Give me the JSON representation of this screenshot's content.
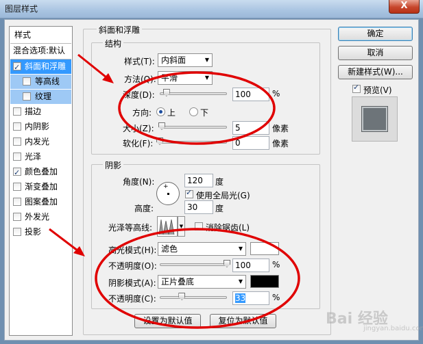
{
  "window": {
    "title": "图层样式",
    "close_glyph": "X"
  },
  "style_list": {
    "header": "样式",
    "blend_default": "混合选项:默认",
    "items": [
      {
        "label": "斜面和浮雕",
        "checked": true,
        "selected": true
      },
      {
        "label": "等高线",
        "checked": false,
        "sub": true
      },
      {
        "label": "纹理",
        "checked": false,
        "sub": true
      },
      {
        "label": "描边",
        "checked": false
      },
      {
        "label": "内阴影",
        "checked": false
      },
      {
        "label": "内发光",
        "checked": false
      },
      {
        "label": "光泽",
        "checked": false
      },
      {
        "label": "颜色叠加",
        "checked": true
      },
      {
        "label": "渐变叠加",
        "checked": false
      },
      {
        "label": "图案叠加",
        "checked": false
      },
      {
        "label": "外发光",
        "checked": false
      },
      {
        "label": "投影",
        "checked": false
      }
    ]
  },
  "bevel": {
    "group_title": "斜面和浮雕",
    "structure_title": "结构",
    "style_label": "样式(T):",
    "style_value": "内斜面",
    "technique_label": "方法(Q):",
    "technique_value": "平滑",
    "depth_label": "深度(D):",
    "depth_value": "100",
    "depth_unit": "%",
    "depth_fraction": 0.1,
    "direction_label": "方向:",
    "direction_up": "上",
    "direction_down": "下",
    "size_label": "大小(Z):",
    "size_value": "5",
    "size_unit": "像素",
    "size_fraction": 0.03,
    "soften_label": "软化(F):",
    "soften_value": "0",
    "soften_unit": "像素",
    "soften_fraction": 0.0
  },
  "shading": {
    "group_title": "阴影",
    "angle_label": "角度(N):",
    "angle_value": "120",
    "angle_unit": "度",
    "global_light_label": "使用全局光(G)",
    "global_light_checked": true,
    "altitude_label": "高度:",
    "altitude_value": "30",
    "altitude_unit": "度",
    "gloss_contour_label": "光泽等高线:",
    "antialias_label": "消除锯齿(L)",
    "antialias_checked": false,
    "highlight_mode_label": "高光模式(H):",
    "highlight_mode_value": "滤色",
    "highlight_color": "#ffffff",
    "highlight_opacity_label": "不透明度(O):",
    "highlight_opacity_value": "100",
    "highlight_opacity_unit": "%",
    "highlight_opacity_fraction": 1.0,
    "shadow_mode_label": "阴影模式(A):",
    "shadow_mode_value": "正片叠底",
    "shadow_color": "#000000",
    "shadow_opacity_label": "不透明度(C):",
    "shadow_opacity_value": "33",
    "shadow_opacity_unit": "%",
    "shadow_opacity_fraction": 0.33
  },
  "footer": {
    "make_default": "设置为默认值",
    "reset_default": "复位为默认值"
  },
  "buttons": {
    "ok": "确定",
    "cancel": "取消",
    "new_style": "新建样式(W)...",
    "preview_label": "预览(V)",
    "preview_checked": true
  },
  "watermark": {
    "text": "Bai 经验",
    "sub": "jingyan.baidu.com"
  },
  "colors": {
    "selection": "#3399ff",
    "annotation": "#e00000"
  }
}
